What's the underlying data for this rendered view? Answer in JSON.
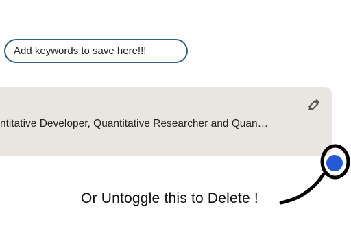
{
  "keyword_input": {
    "placeholder": "Add keywords to save here!!!"
  },
  "saved_search_card": {
    "text": "ntitative Developer, Quantitative Researcher and Quan…",
    "edit_icon": "pencil-icon"
  },
  "toggle": {
    "state": "on",
    "color": "#2659d6"
  },
  "annotation": {
    "text": "Or Untoggle this to Delete !"
  }
}
